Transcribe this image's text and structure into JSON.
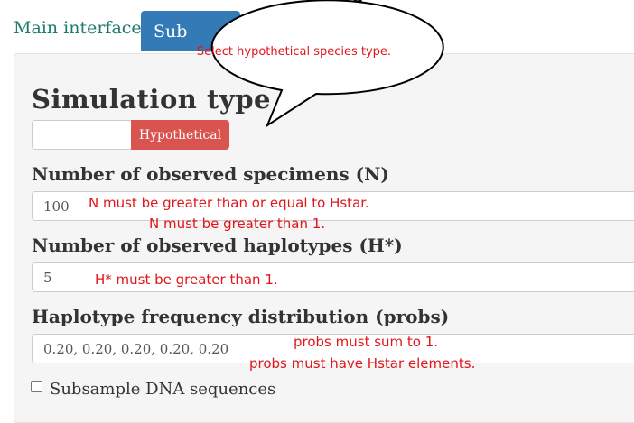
{
  "tabs": {
    "main": "Main interface",
    "sub": "Sub"
  },
  "form": {
    "sim_type_heading": "Simulation type",
    "sim_type_active": "Hypothetical",
    "n_label": "Number of observed specimens (N)",
    "n_value": "100",
    "h_label": "Number of observed haplotypes (H*)",
    "h_value": "5",
    "probs_label": "Haplotype frequency distribution (probs)",
    "probs_value": "0.20, 0.20, 0.20, 0.20, 0.20",
    "subsample_label": "Subsample DNA sequences"
  },
  "annotations": {
    "bubble": "Select hypothetical species type.",
    "n_err1": "N must be greater than or equal to Hstar.",
    "n_err2": "N must be greater than 1.",
    "h_err": "H* must be greater than 1.",
    "p_err1": "probs must sum to 1.",
    "p_err2": "probs must have Hstar elements."
  },
  "colors": {
    "tab_active": "#337ab7",
    "button_danger": "#d9534f",
    "annotation_red": "#e0161b",
    "link_green": "#1e7b6b"
  }
}
